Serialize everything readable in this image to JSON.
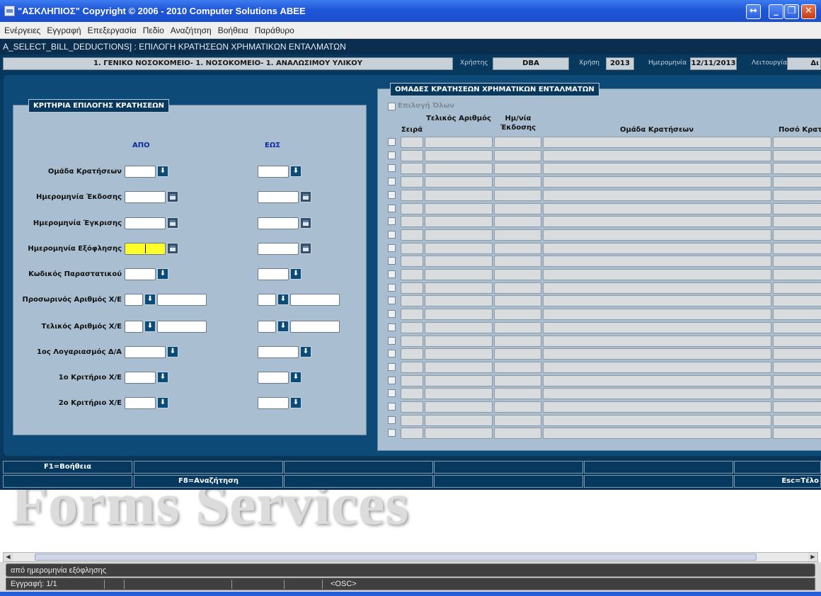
{
  "window": {
    "title": "\"ΑΣΚΛΗΠΙΟΣ\" Copyright © 2006 - 2010 Computer Solutions ΑΒΕΕ",
    "buttons": [
      "↔",
      "_",
      "❐",
      "✕"
    ]
  },
  "menu": [
    "Ενέργειες",
    "Εγγραφή",
    "Επεξεργασία",
    "Πεδίο",
    "Αναζήτηση",
    "Βοήθεια",
    "Παράθυρο"
  ],
  "form_title": "A_SELECT_BILL_DEDUCTIONS]  :  ΕΠΙΛΟΓΗ ΚΡΑΤΗΣΕΩΝ ΧΡΗΜΑΤΙΚΩΝ ΕΝΤΑΛΜΑΤΩΝ",
  "info": {
    "hospital": "1. ΓΕΝΙΚΟ ΝΟΣΟΚΟΜΕΙΟ- 1. ΝΟΣΟΚΟΜΕΙΟ- 1. ΑΝΑΛΩΣΙΜΟΥ ΥΛΙΚΟΥ",
    "user_label": "Χρήστης",
    "user_value": "DBA",
    "year_label": "Χρήση",
    "year_value": "2013",
    "date_label": "Ημερομηνία",
    "date_value": "12/11/2013",
    "function_label": "Λειτουργία",
    "function_value": "Δι"
  },
  "criteria": {
    "title": "ΚΡΙΤΗΡΙΑ ΕΠΙΛΟΓΗΣ ΚΡΑΤΗΣΕΩΝ",
    "from_header": "ΑΠΟ",
    "to_header": "ΕΩΣ",
    "rows": [
      {
        "label": "Ομάδα Κρατήσεων",
        "kind": "lov"
      },
      {
        "label": "Ημερομηνία Έκδοσης",
        "kind": "date"
      },
      {
        "label": "Ημερομηνία Έγκρισης",
        "kind": "date"
      },
      {
        "label": "Ημερομηνία Εξόφλησης",
        "kind": "date",
        "focused": true
      },
      {
        "label": "Κωδικός Παραστατικού",
        "kind": "lov"
      },
      {
        "label": "Προσωρινός Αριθμός Χ/Ε",
        "kind": "split"
      },
      {
        "label": "Τελικός Αριθμός Χ/Ε",
        "kind": "split"
      },
      {
        "label": "1ος Λογαριασμός Δ/Α",
        "kind": "lov_wide"
      },
      {
        "label": "1ο Κριτήριο Χ/Ε",
        "kind": "lov"
      },
      {
        "label": "2ο Κριτήριο Χ/Ε",
        "kind": "lov"
      }
    ]
  },
  "groups": {
    "title": "ΟΜΑΔΕΣ ΚΡΑΤΗΣΕΩΝ ΧΡΗΜΑΤΙΚΩΝ ΕΝΤΑΛΜΑΤΩΝ",
    "select_all": "Επιλογή Όλων",
    "headers": {
      "seira": "Σειρά",
      "final_number": "Τελικός Αριθμός",
      "issue_date": "Ημ/νία Έκδοσης",
      "group": "Ομάδα Κρατήσεων",
      "amount": "Ποσό Κρατ"
    },
    "row_count": 23
  },
  "function_keys": {
    "row1": [
      "F1=Βοήθεια",
      "",
      "",
      "",
      "",
      ""
    ],
    "row2": [
      "",
      "F8=Αναζήτηση",
      "",
      "",
      "",
      "Esc=Τέλο"
    ]
  },
  "watermark": "Forms Services",
  "status": {
    "message": "από ημερομηνία εξόφλησης",
    "record": "Εγγραφή: 1/1",
    "mode": "<OSC>"
  },
  "colors": {
    "dark_blue": "#07385e",
    "panel": "#a9bed1",
    "focus_yellow": "#ffff2a",
    "header_text": "#0d2a9c"
  }
}
